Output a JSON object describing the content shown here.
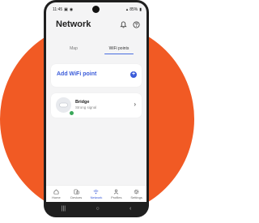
{
  "status_bar": {
    "time": "11:45",
    "battery": "85%"
  },
  "header": {
    "title": "Network",
    "bell_icon": "bell-icon",
    "help_icon": "help-icon"
  },
  "tabs": [
    {
      "label": "Map",
      "active": false
    },
    {
      "label": "WiFi points",
      "active": true
    }
  ],
  "add_point": {
    "label": "Add WiFi point",
    "icon": "plus-icon"
  },
  "devices": [
    {
      "name": "Bridge",
      "status": "Strong signal",
      "status_color": "#3aa85a"
    }
  ],
  "bottom_nav": [
    {
      "label": "Home",
      "icon": "home-icon",
      "active": false
    },
    {
      "label": "Devices",
      "icon": "devices-icon",
      "active": false
    },
    {
      "label": "Network",
      "icon": "wifi-icon",
      "active": true
    },
    {
      "label": "Profiles",
      "icon": "profiles-icon",
      "active": false
    },
    {
      "label": "Settings",
      "icon": "gear-icon",
      "active": false
    }
  ],
  "colors": {
    "accent": "#3a5bd9",
    "background_circle": "#f15a24",
    "phone_body": "#1f1f1f"
  }
}
